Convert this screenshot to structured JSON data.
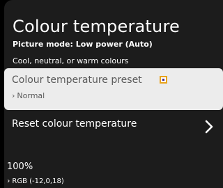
{
  "panel": {
    "title": "Colour temperature",
    "subtitle": "Picture mode: Low power (Auto)",
    "description": "Cool, neutral, or warm colours"
  },
  "items": [
    {
      "label": "Colour temperature preset",
      "value": "Normal",
      "selected": true
    },
    {
      "label": "Reset colour temperature",
      "selected": false
    }
  ],
  "footer": {
    "percent": "100%",
    "rgb": "RGB (-12,0,18)"
  },
  "colors": {
    "background": "#000000",
    "panel": "#1c1c1c",
    "selected_row": "#ececec",
    "focus_marker": "#e8a31c"
  },
  "icons": {
    "value_chevron": "chevron-right-icon",
    "row_chevron": "chevron-right-icon",
    "focus": "focus-marker-icon"
  }
}
